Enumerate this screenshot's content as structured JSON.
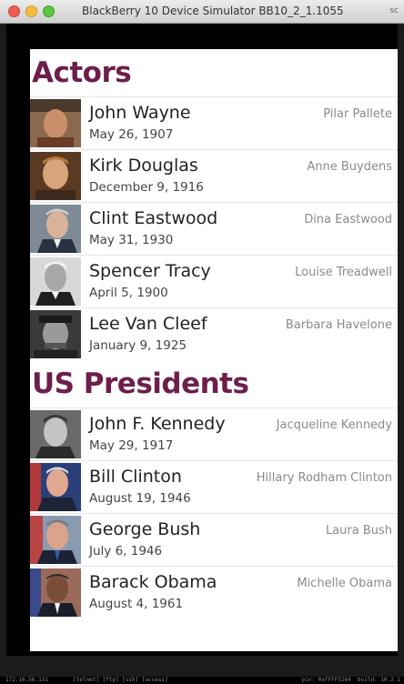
{
  "window": {
    "title": "BlackBerry 10 Device Simulator BB10_2_1.1055",
    "corner": "sc"
  },
  "sections": [
    {
      "title": "Actors",
      "items": [
        {
          "name": "John Wayne",
          "date": "May 26, 1907",
          "spouse": "Pilar Pallete"
        },
        {
          "name": "Kirk Douglas",
          "date": "December 9, 1916",
          "spouse": "Anne Buydens"
        },
        {
          "name": "Clint Eastwood",
          "date": "May 31, 1930",
          "spouse": "Dina Eastwood"
        },
        {
          "name": "Spencer Tracy",
          "date": "April 5, 1900",
          "spouse": "Louise Treadwell"
        },
        {
          "name": "Lee Van Cleef",
          "date": "January 9, 1925",
          "spouse": "Barbara Havelone"
        }
      ]
    },
    {
      "title": "US Presidents",
      "items": [
        {
          "name": "John F. Kennedy",
          "date": "May 29, 1917",
          "spouse": "Jacqueline Kennedy"
        },
        {
          "name": "Bill Clinton",
          "date": "August 19, 1946",
          "spouse": "Hillary Rodham Clinton"
        },
        {
          "name": "George Bush",
          "date": "July 6, 1946",
          "spouse": "Laura Bush"
        },
        {
          "name": "Barack Obama",
          "date": "August 4, 1961",
          "spouse": "Michelle Obama"
        }
      ]
    }
  ],
  "statusbar": {
    "ip": "172.16.56.131",
    "keys": "[telnet] [ftp] [ssh] [access]",
    "pin": "pin: 0xFFFF5264",
    "build": "build: 10.2.1"
  },
  "colors": {
    "accent": "#6d1e4b",
    "divider": "#e6e6e6",
    "secondary_text": "#8a8a8a"
  }
}
